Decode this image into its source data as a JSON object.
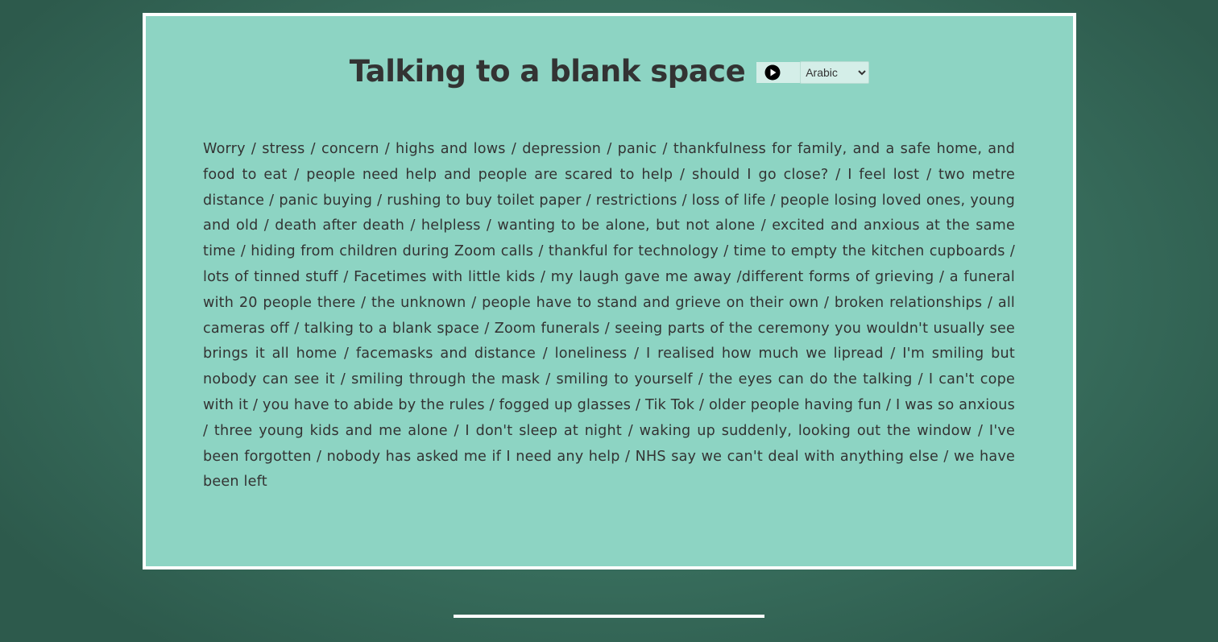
{
  "page": {
    "title": "Talking to a blank space",
    "body_text": "Worry / stress / concern / highs and lows / depression / panic / thankfulness for family, and a safe home, and food to eat / people need help and people are scared to help / should I go close? / I feel lost / two metre distance / panic buying / rushing to buy toilet paper / restrictions / loss of life / people losing loved ones, young and old / death after death / helpless / wanting to be alone, but not alone / excited and anxious at the same time / hiding from children during Zoom calls / thankful for technology / time to empty the kitchen cupboards / lots of tinned stuff / Facetimes with little kids / my laugh gave me away /different forms of grieving / a funeral with 20 people there / the unknown / people have to stand and grieve on their own / broken relationships / all cameras off / talking to a blank space / Zoom funerals / seeing parts of the ceremony you wouldn't usually see brings it all home / facemasks and distance / loneliness / I realised how much we lipread / I'm smiling but nobody can see it / smiling through the mask / smiling to yourself / the eyes can do the talking / I can't cope with it / you have to abide by the rules / fogged up glasses / Tik Tok / older people having fun / I was so anxious / three young kids and me alone / I don't sleep at night / waking up suddenly, looking out the window / I've been forgotten / nobody has asked me if I need any help / NHS say we can't deal with anything else / we have been left"
  },
  "audio": {
    "play_icon": "play-circle-icon",
    "language_selected": "Arabic"
  },
  "colors": {
    "background_dark": "#2d5a4c",
    "background_light": "#4e8d78",
    "card": "#8dd4c3",
    "card_border": "#ffffff",
    "text": "#333333",
    "control_bg": "#d4eee8"
  }
}
